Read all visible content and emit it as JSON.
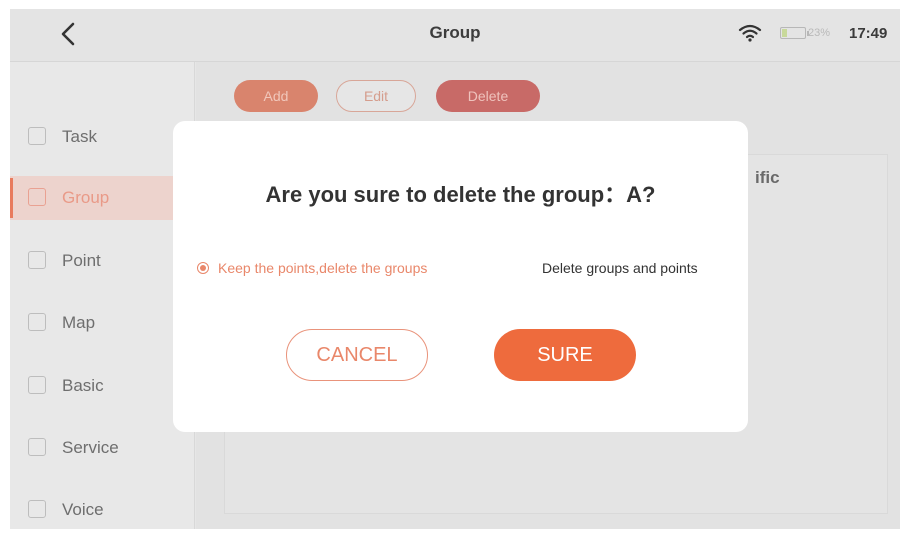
{
  "header": {
    "back_icon": "chevron-left-icon",
    "title": "Group",
    "status": {
      "wifi_icon": "wifi-icon",
      "battery_icon": "battery-icon",
      "battery_percent": "23%",
      "battery_level": 0.23,
      "time": "17:49"
    }
  },
  "sidebar": {
    "items": [
      {
        "label": "Task",
        "icon": "task-icon"
      },
      {
        "label": "Group",
        "icon": "group-icon",
        "active": true
      },
      {
        "label": "Point",
        "icon": "point-icon"
      },
      {
        "label": "Map",
        "icon": "map-icon"
      },
      {
        "label": "Basic",
        "icon": "basic-icon"
      },
      {
        "label": "Service",
        "icon": "service-icon"
      },
      {
        "label": "Voice",
        "icon": "voice-icon"
      }
    ]
  },
  "toolbar": {
    "add_label": "Add",
    "edit_label": "Edit",
    "delete_label": "Delete"
  },
  "main": {
    "partial_text": "ific"
  },
  "dialog": {
    "title": "Are you sure to delete the group：A?",
    "options": [
      {
        "label": "Keep the points,delete the groups",
        "selected": true
      },
      {
        "label": "Delete groups and points",
        "selected": false
      }
    ],
    "cancel_label": "CANCEL",
    "sure_label": "SURE"
  },
  "colors": {
    "accent": "#ee6b3d",
    "accent_text": "#e9876a",
    "delete_pill": "#c86a67",
    "overlay_bg": "#e6e6e6"
  }
}
